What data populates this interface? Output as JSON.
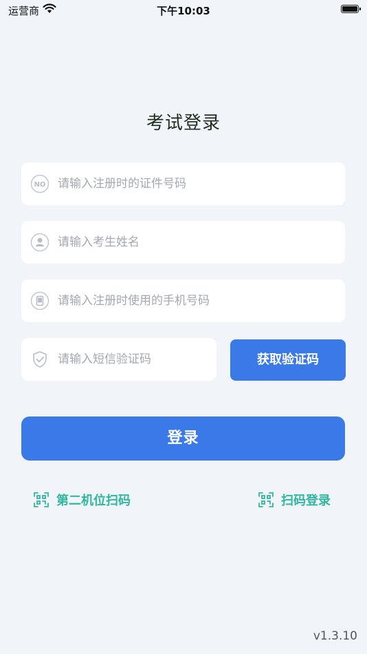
{
  "status_bar": {
    "carrier": "运营商",
    "time": "下午10:03",
    "battery_level": 1.0
  },
  "title": "考试登录",
  "form": {
    "id_placeholder": "请输入注册时的证件号码",
    "name_placeholder": "请输入考生姓名",
    "phone_placeholder": "请输入注册时使用的手机号码",
    "code_placeholder": "请输入短信验证码",
    "get_code_label": "获取验证码",
    "id_icon_text": "NO"
  },
  "login_label": "登录",
  "links": {
    "second_camera_label": "第二机位扫码",
    "scan_login_label": "扫码登录"
  },
  "version": "v1.3.10",
  "colors": {
    "background": "#f1f4f8",
    "primary": "#3a79e8",
    "link": "#2fb7a0",
    "placeholder": "#a3a8b2"
  },
  "icons": {
    "id": "id-card-no-icon",
    "name": "person-icon",
    "phone": "phone-icon",
    "code": "shield-check-icon",
    "scan": "qr-scan-icon"
  }
}
